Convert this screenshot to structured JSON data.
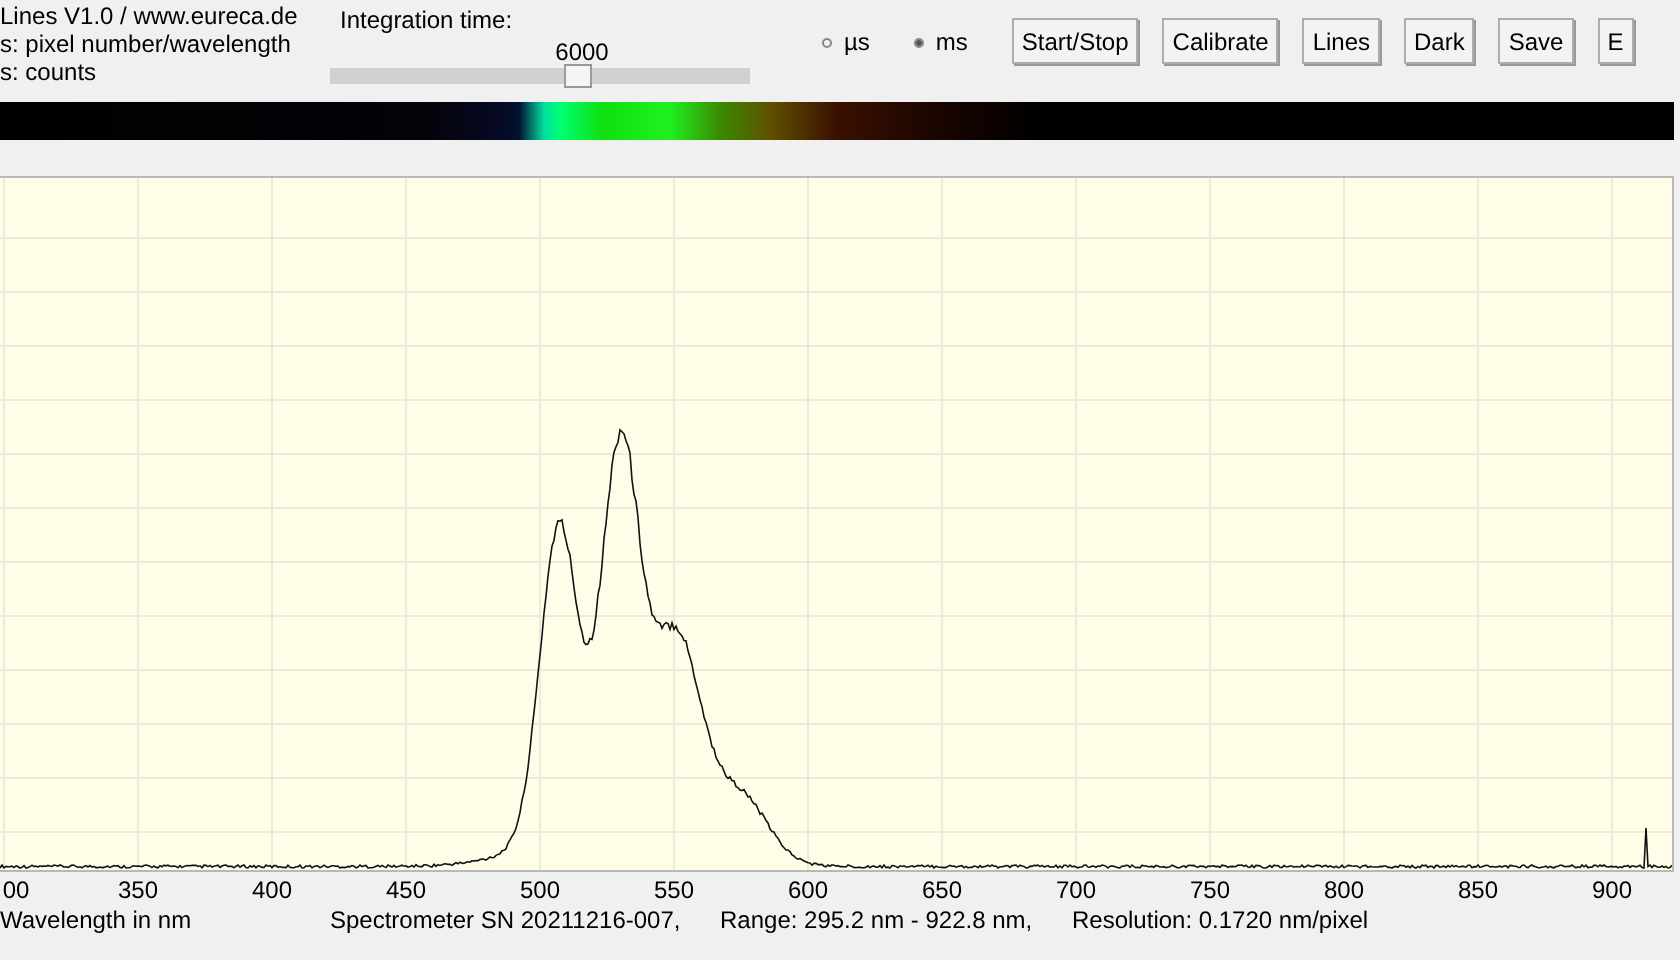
{
  "info_lines": [
    "Lines V1.0 / www.eureca.de",
    "s: pixel number/wavelength",
    "s: counts"
  ],
  "integration": {
    "label": "Integration time:",
    "value": "6000",
    "level": 0.59
  },
  "units": [
    {
      "label": "µs",
      "selected": false
    },
    {
      "label": "ms",
      "selected": true
    }
  ],
  "buttons": [
    "Start/Stop",
    "Calibrate",
    "Lines",
    "Dark",
    "Save",
    "E"
  ],
  "x_ticks": [
    "00",
    "350",
    "400",
    "450",
    "500",
    "550",
    "600",
    "650",
    "700",
    "750",
    "800",
    "850",
    "900"
  ],
  "status_bar": [
    "Wavelength in nm",
    "Spectrometer SN 20211216-007,",
    "Range: 295.2 nm - 922.8 nm,",
    "Resolution: 0.1720 nm/pixel"
  ]
}
